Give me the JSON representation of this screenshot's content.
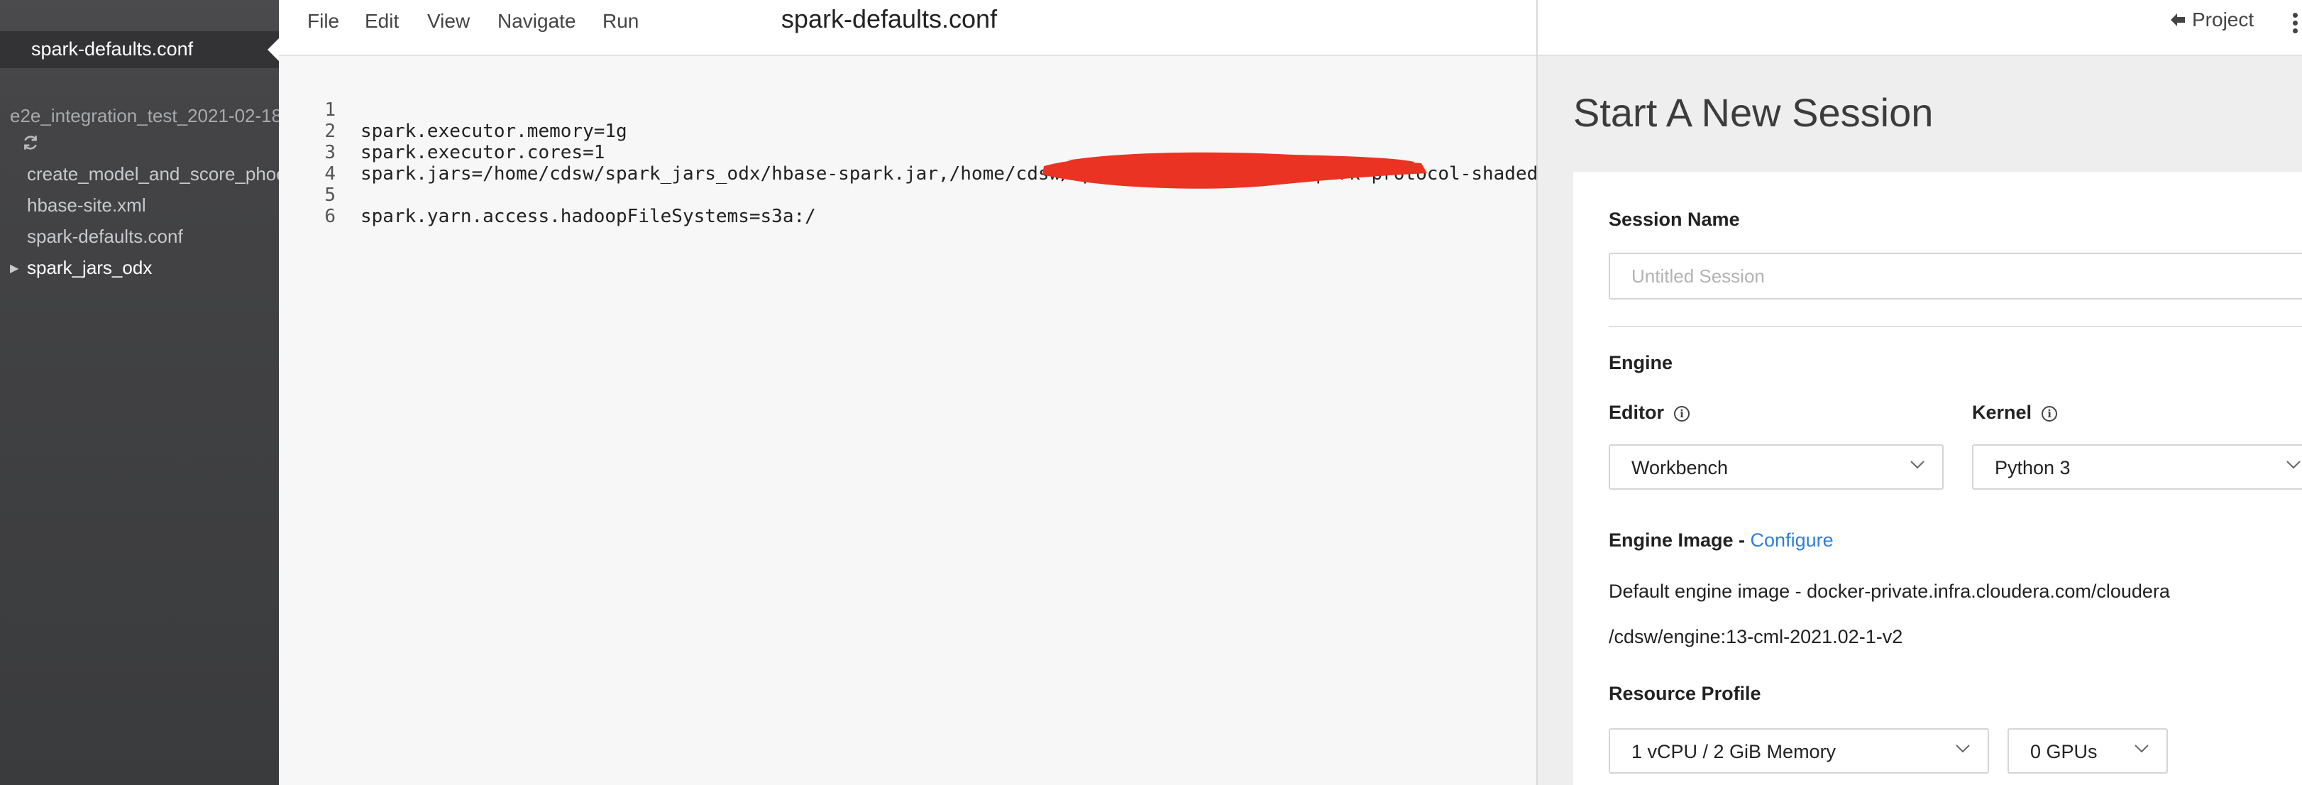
{
  "sidebar": {
    "open_tab": "spark-defaults.conf",
    "project_root": "e2e_integration_test_2021-02-18",
    "files": [
      "create_model_and_score_phoenix",
      "hbase-site.xml",
      "spark-defaults.conf"
    ],
    "folder": "spark_jars_odx"
  },
  "menubar": {
    "items": [
      "File",
      "Edit",
      "View",
      "Navigate",
      "Run"
    ],
    "title": "spark-defaults.conf"
  },
  "code": {
    "lines": [
      {
        "n": "1",
        "text": "spark.executor.memory=1g"
      },
      {
        "n": "2",
        "text": "spark.executor.cores=1"
      },
      {
        "n": "3",
        "text": "spark.jars=/home/cdsw/spark_jars_odx/hbase-spark.jar,/home/cdsw/spark_jars_odx/hbase-spark-protocol-shaded"
      },
      {
        "n": "4",
        "text": ""
      },
      {
        "n": "5",
        "text": "spark.yarn.access.hadoopFileSystems=s3a:/"
      },
      {
        "n": "6",
        "text": ""
      }
    ]
  },
  "right_panel": {
    "project_link": "Project",
    "heading": "Start A New Session",
    "session_name_label": "Session Name",
    "session_name_value": "",
    "session_name_placeholder": "Untitled Session",
    "engine_label": "Engine",
    "editor_label": "Editor",
    "editor_value": "Workbench",
    "kernel_label": "Kernel",
    "kernel_value": "Python 3",
    "engine_image_label": "Engine Image - ",
    "configure_link": "Configure",
    "engine_image_line1": "Default engine image - docker-private.infra.cloudera.com/cloudera",
    "engine_image_line2": "/cdsw/engine:13-cml-2021.02-1-v2",
    "resource_profile_label": "Resource Profile",
    "resource_value": "1 vCPU / 2 GiB Memory",
    "gpus_value": "0 GPUs"
  },
  "colors": {
    "sidebar_bg": "#444446",
    "editor_bg": "#f7f7f7",
    "panel_bg": "#eeeeee",
    "link": "#2f7fd6",
    "redaction": "#ea3323"
  },
  "icons": [
    "refresh-icon",
    "folder-caret-icon",
    "back-arrow-icon",
    "kebab-menu-icon",
    "info-icon",
    "chevron-down-icon"
  ]
}
